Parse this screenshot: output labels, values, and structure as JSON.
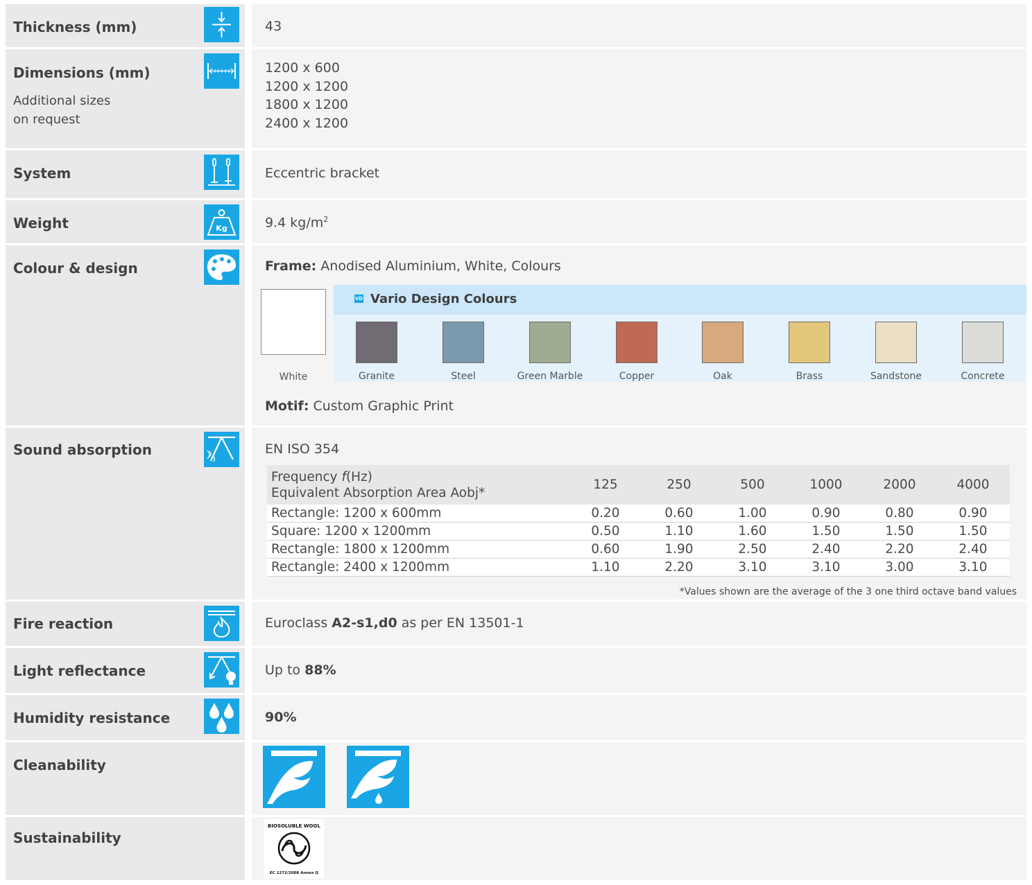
{
  "rows": {
    "thickness": {
      "label": "Thickness (mm)",
      "value": "43",
      "icon": "thickness-icon"
    },
    "dimensions": {
      "label": "Dimensions (mm)",
      "sub1": "Additional sizes",
      "sub2": "on request",
      "values": [
        "1200 x 600",
        "1200 x 1200",
        "1800 x 1200",
        "2400 x 1200"
      ],
      "icon": "dimensions-icon"
    },
    "system": {
      "label": "System",
      "value": "Eccentric bracket",
      "icon": "system-icon"
    },
    "weight": {
      "label": "Weight",
      "value": "9.4 kg/m",
      "sup": "2",
      "icon_text": "Kg",
      "icon": "weight-icon"
    },
    "colour": {
      "label": "Colour & design",
      "frame_label": "Frame:",
      "frame_value": "Anodised Aluminium, White, Colours",
      "white_label": "White",
      "vd_badge": "VD",
      "vd_title": "Vario Design Colours",
      "swatches": [
        {
          "name": "Granite",
          "color": "#716c74"
        },
        {
          "name": "Steel",
          "color": "#7b9aad"
        },
        {
          "name": "Green Marble",
          "color": "#a0ac92"
        },
        {
          "name": "Copper",
          "color": "#c06a55"
        },
        {
          "name": "Oak",
          "color": "#d6aa7c"
        },
        {
          "name": "Brass",
          "color": "#e3c77d"
        },
        {
          "name": "Sandstone",
          "color": "#ebdfc5"
        },
        {
          "name": "Concrete",
          "color": "#dcdcd8"
        }
      ],
      "motif_label": "Motif:",
      "motif_value": "Custom Graphic Print",
      "icon": "palette-icon"
    },
    "sound": {
      "label": "Sound absorption",
      "standard": "EN ISO 354",
      "header_line1_a": "Frequency ",
      "header_f": "f",
      "header_line1_b": "(Hz)",
      "header_line2": "Equivalent Absorption Area Aobj*",
      "frequencies": [
        "125",
        "250",
        "500",
        "1000",
        "2000",
        "4000"
      ],
      "table": [
        {
          "name": "Rectangle: 1200 x 600mm",
          "values": [
            "0.20",
            "0.60",
            "1.00",
            "0.90",
            "0.80",
            "0.90"
          ]
        },
        {
          "name": "Square: 1200 x 1200mm",
          "values": [
            "0.50",
            "1.10",
            "1.60",
            "1.50",
            "1.50",
            "1.50"
          ]
        },
        {
          "name": "Rectangle: 1800 x 1200mm",
          "values": [
            "0.60",
            "1.90",
            "2.50",
            "2.40",
            "2.20",
            "2.40"
          ]
        },
        {
          "name": "Rectangle: 2400 x 1200mm",
          "values": [
            "1.10",
            "2.20",
            "3.10",
            "3.10",
            "3.00",
            "3.10"
          ]
        }
      ],
      "note": "*Values shown are the average of the 3 one third octave band values",
      "icon": "sound-absorption-icon"
    },
    "fire": {
      "label": "Fire reaction",
      "pre": "Euroclass ",
      "bold": "A2-s1,d0",
      "post": " as per EN 13501-1",
      "icon": "fire-icon"
    },
    "light": {
      "label": "Light reflectance",
      "pre": "Up to ",
      "bold": "88%",
      "icon": "light-reflectance-icon"
    },
    "humidity": {
      "label": "Humidity resistance",
      "bold": "90%",
      "icon": "humidity-icon"
    },
    "clean": {
      "label": "Cleanability",
      "icons": [
        "dry-clean-icon",
        "wet-clean-icon"
      ]
    },
    "sustain": {
      "label": "Sustainability",
      "logo_top": "BIOSOLUBLE WOOL",
      "logo_bottom": "EC 1272/2008 Annex Q"
    }
  },
  "colors": {
    "accent": "#1aa6e4",
    "label_bg": "#e9e9ec",
    "value_bg": "#f4f4f5"
  }
}
